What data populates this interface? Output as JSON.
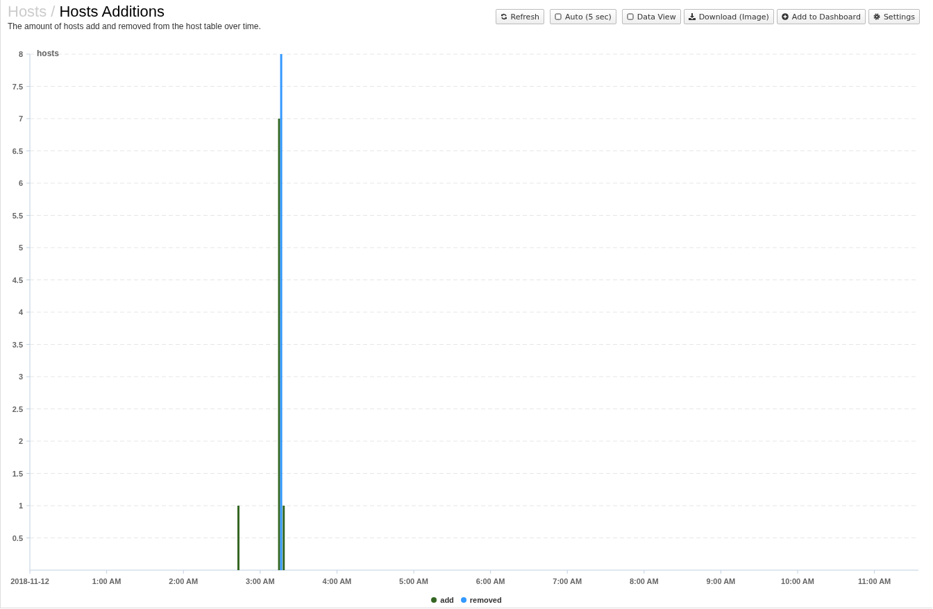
{
  "breadcrumb": {
    "parent": "Hosts",
    "separator": "/",
    "title": "Hosts Additions"
  },
  "description": "The amount of hosts add and removed from the host table over time.",
  "toolbar": [
    {
      "kind": "refresh",
      "label": "Refresh"
    },
    {
      "kind": "toggle",
      "label": "Auto (5 sec)",
      "checked": false
    },
    {
      "kind": "toggle",
      "label": "Data View",
      "checked": false
    },
    {
      "kind": "download",
      "label": "Download (Image)"
    },
    {
      "kind": "add",
      "label": "Add to Dashboard"
    },
    {
      "kind": "settings",
      "label": "Settings"
    }
  ],
  "chart_data": {
    "type": "bar",
    "ylabel": "hosts",
    "x": [
      2.73,
      3.26,
      3.32
    ],
    "series": [
      {
        "name": "add",
        "color": "#336622",
        "values": [
          1,
          7,
          1
        ]
      },
      {
        "name": "removed",
        "color": "#3399ff",
        "values": [
          null,
          8,
          null
        ]
      }
    ],
    "grid": true,
    "legend": true,
    "xlim": [
      0,
      11.573
    ],
    "ylim": [
      0,
      8
    ],
    "xticks": [
      {
        "value": 0,
        "label": "2018-11-12"
      },
      {
        "value": 1,
        "label": "1:00 AM"
      },
      {
        "value": 2,
        "label": "2:00 AM"
      },
      {
        "value": 3,
        "label": "3:00 AM"
      },
      {
        "value": 4,
        "label": "4:00 AM"
      },
      {
        "value": 5,
        "label": "5:00 AM"
      },
      {
        "value": 6,
        "label": "6:00 AM"
      },
      {
        "value": 7,
        "label": "7:00 AM"
      },
      {
        "value": 8,
        "label": "8:00 AM"
      },
      {
        "value": 9,
        "label": "9:00 AM"
      },
      {
        "value": 10,
        "label": "10:00 AM"
      },
      {
        "value": 11,
        "label": "11:00 AM"
      }
    ],
    "yticks": [
      0.5,
      1,
      1.5,
      2,
      2.5,
      3,
      3.5,
      4,
      4.5,
      5,
      5.5,
      6,
      6.5,
      7,
      7.5,
      8
    ]
  }
}
